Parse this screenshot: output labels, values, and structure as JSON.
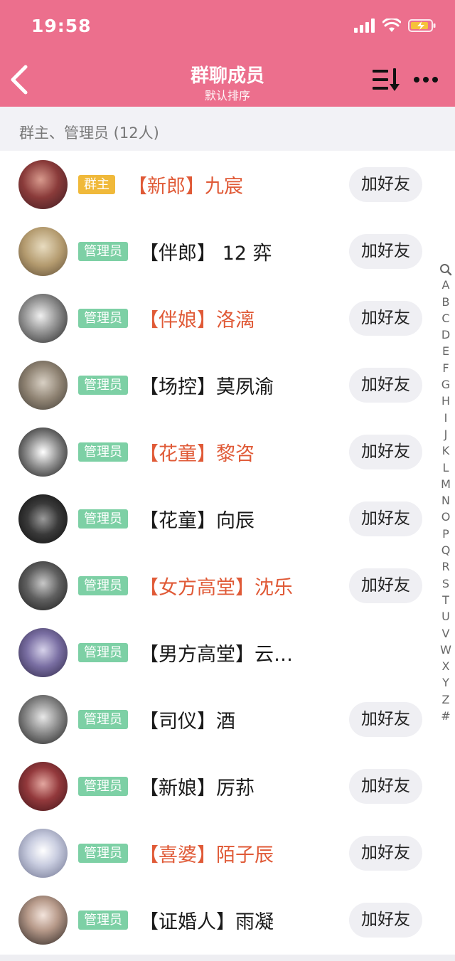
{
  "status": {
    "time": "19:58"
  },
  "header": {
    "title": "群聊成员",
    "subtitle": "默认排序"
  },
  "section": {
    "label": "群主、管理员 (12人)"
  },
  "members": [
    {
      "role": "群主",
      "name": "【新郎】九宸",
      "highlight": true,
      "action": "加好友"
    },
    {
      "role": "管理员",
      "name": "【伴郎】 12 弈",
      "highlight": false,
      "action": "加好友"
    },
    {
      "role": "管理员",
      "name": "【伴娘】洛漓",
      "highlight": true,
      "action": "加好友"
    },
    {
      "role": "管理员",
      "name": "【场控】莫夙渝",
      "highlight": false,
      "action": "加好友"
    },
    {
      "role": "管理员",
      "name": "【花童】黎咨",
      "highlight": true,
      "action": "加好友"
    },
    {
      "role": "管理员",
      "name": "【花童】向辰",
      "highlight": false,
      "action": "加好友"
    },
    {
      "role": "管理员",
      "name": "【女方高堂】沈乐",
      "highlight": true,
      "action": "加好友"
    },
    {
      "role": "管理员",
      "name": "【男方高堂】云…",
      "highlight": false,
      "action": ""
    },
    {
      "role": "管理员",
      "name": "【司仪】酒",
      "highlight": false,
      "action": "加好友"
    },
    {
      "role": "管理员",
      "name": "【新娘】厉荪",
      "highlight": false,
      "action": "加好友"
    },
    {
      "role": "管理员",
      "name": "【喜婆】陌子辰",
      "highlight": true,
      "action": "加好友"
    },
    {
      "role": "管理员",
      "name": "【证婚人】雨凝",
      "highlight": false,
      "action": "加好友"
    }
  ],
  "index": [
    "A",
    "B",
    "C",
    "D",
    "E",
    "F",
    "G",
    "H",
    "I",
    "J",
    "K",
    "L",
    "M",
    "N",
    "O",
    "P",
    "Q",
    "R",
    "S",
    "T",
    "U",
    "V",
    "W",
    "X",
    "Y",
    "Z",
    "#"
  ],
  "colors": {
    "header": "#ec6f8d",
    "owner_badge": "#f0b93a",
    "admin_badge": "#7dd0a5",
    "highlight_name": "#e05a37"
  }
}
